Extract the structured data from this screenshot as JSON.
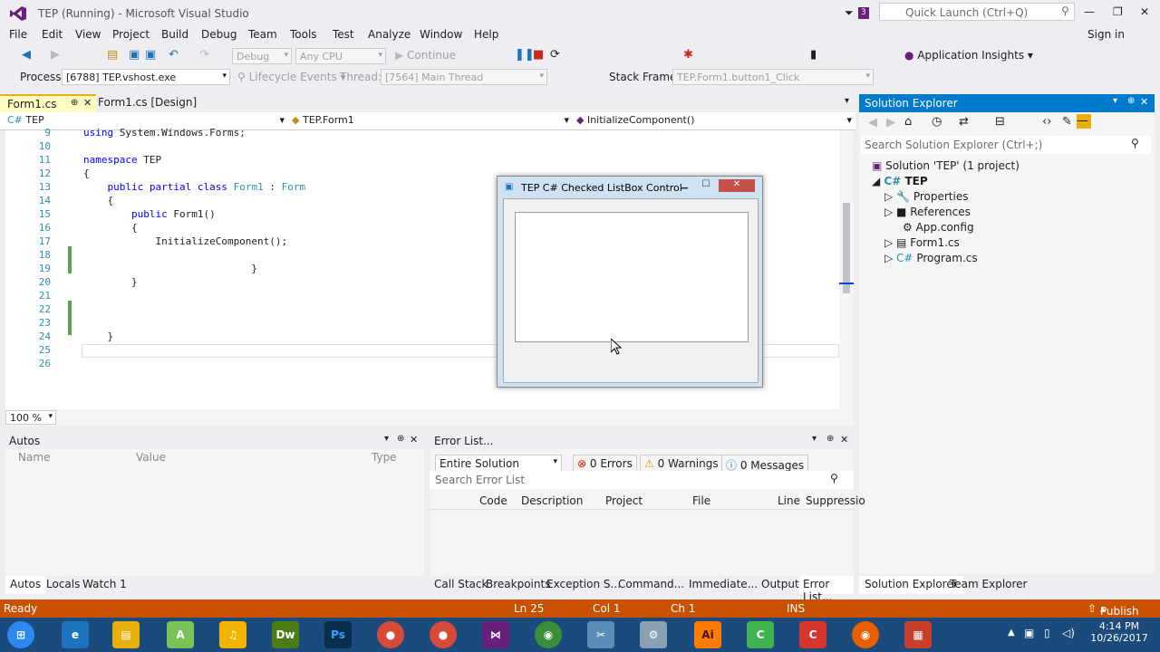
{
  "titlebar": {
    "title": "TEP (Running) - Microsoft Visual Studio",
    "notifications": "3",
    "quick_launch_placeholder": "Quick Launch (Ctrl+Q)"
  },
  "menu": [
    "File",
    "Edit",
    "View",
    "Project",
    "Build",
    "Debug",
    "Team",
    "Tools",
    "Test",
    "Analyze",
    "Window",
    "Help"
  ],
  "signin": "Sign in",
  "toolbar1": {
    "config": "Debug",
    "platform": "Any CPU",
    "continue": "Continue",
    "app_insights": "Application Insights"
  },
  "toolbar2": {
    "process_label": "Process:",
    "process": "[6788] TEP.vshost.exe",
    "lifecycle": "Lifecycle Events",
    "thread_label": "Thread:",
    "thread": "[7564] Main Thread",
    "stack_label": "Stack Frame:",
    "stack": "TEP.Form1.button1_Click"
  },
  "doctabs": {
    "active": "Form1.cs",
    "second": "Form1.cs [Design]"
  },
  "navbar": {
    "project": "TEP",
    "class": "TEP.Form1",
    "member": "InitializeComponent()"
  },
  "code": [
    {
      "n": "9",
      "t": "using System.Windows.Forms;"
    },
    {
      "n": "10",
      "t": ""
    },
    {
      "n": "11",
      "t": "namespace TEP"
    },
    {
      "n": "12",
      "t": "{"
    },
    {
      "n": "13",
      "t": "    public partial class Form1 : Form"
    },
    {
      "n": "14",
      "t": "    {"
    },
    {
      "n": "15",
      "t": "        public Form1()"
    },
    {
      "n": "16",
      "t": "        {"
    },
    {
      "n": "17",
      "t": "            InitializeComponent();"
    },
    {
      "n": "18",
      "t": ""
    },
    {
      "n": "19",
      "t": "                            }"
    },
    {
      "n": "20",
      "t": "        }"
    },
    {
      "n": "21",
      "t": ""
    },
    {
      "n": "22",
      "t": ""
    },
    {
      "n": "23",
      "t": ""
    },
    {
      "n": "24",
      "t": "    }"
    },
    {
      "n": "25",
      "t": ""
    },
    {
      "n": "26",
      "t": ""
    }
  ],
  "zoom": "100 %",
  "form_window": {
    "title": "TEP C# Checked ListBox Control"
  },
  "solution_explorer": {
    "title": "Solution Explorer",
    "search_placeholder": "Search Solution Explorer (Ctrl+;)",
    "solution": "Solution 'TEP' (1 project)",
    "project": "TEP",
    "items": [
      "Properties",
      "References",
      "App.config",
      "Form1.cs",
      "Program.cs"
    ],
    "tabs": [
      "Solution Explorer",
      "Team Explorer"
    ]
  },
  "autos": {
    "title": "Autos",
    "columns": [
      "Name",
      "Value",
      "Type"
    ],
    "tabs": [
      "Autos",
      "Locals",
      "Watch 1"
    ]
  },
  "errors": {
    "title": "Error List...",
    "scope": "Entire Solution",
    "errors": "0 Errors",
    "warnings": "0 Warnings",
    "messages": "0 Messages",
    "search_placeholder": "Search Error List",
    "columns": [
      "Code",
      "Description",
      "Project",
      "File",
      "Line",
      "Suppressio"
    ],
    "tabs": [
      "Call Stack",
      "Breakpoints",
      "Exception S...",
      "Command...",
      "Immediate...",
      "Output",
      "Error List..."
    ]
  },
  "status": {
    "ready": "Ready",
    "ln": "Ln 25",
    "col": "Col 1",
    "ch": "Ch 1",
    "ins": "INS",
    "publish": "Publish"
  },
  "taskbar": {
    "time": "4:14 PM",
    "date": "10/26/2017"
  }
}
